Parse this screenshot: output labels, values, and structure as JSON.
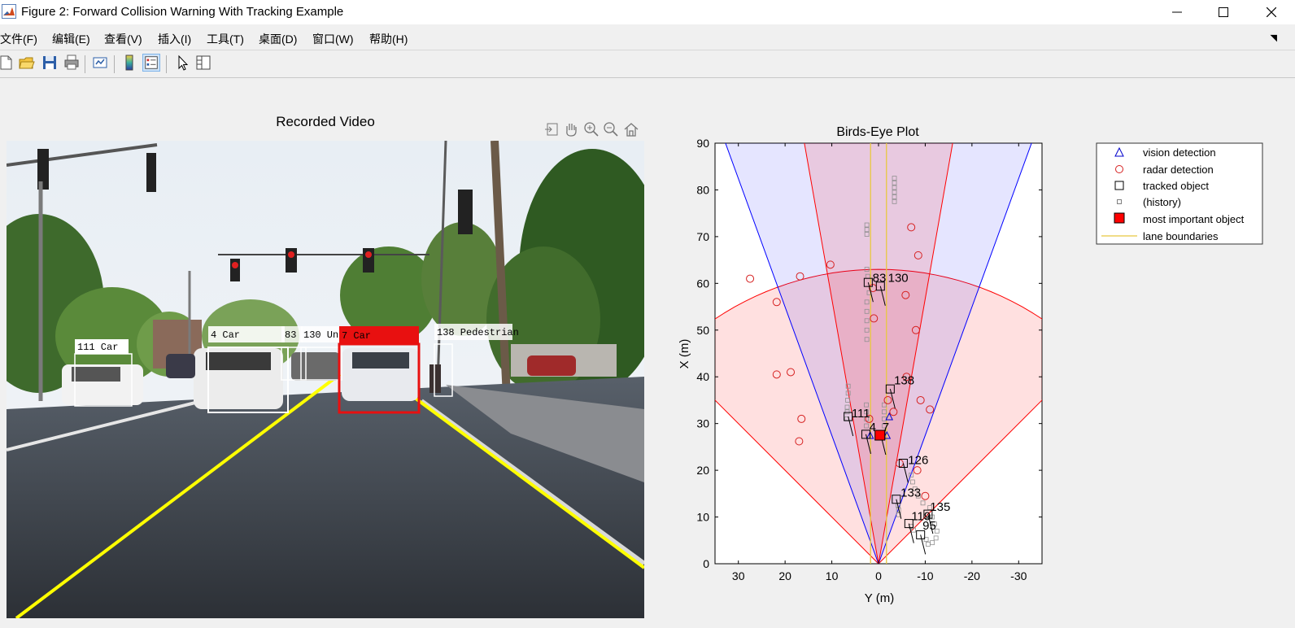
{
  "window": {
    "title": "Figure 2: Forward Collision Warning With Tracking Example",
    "controls": [
      "minimize",
      "maximize",
      "close"
    ]
  },
  "menu": [
    {
      "label": "文件(F)"
    },
    {
      "label": "编辑(E)"
    },
    {
      "label": "查看(V)"
    },
    {
      "label": "插入(I)"
    },
    {
      "label": "工具(T)"
    },
    {
      "label": "桌面(D)"
    },
    {
      "label": "窗口(W)"
    },
    {
      "label": "帮助(H)"
    }
  ],
  "toolbar": {
    "icons": [
      "new-figure-icon",
      "open-file-icon",
      "save-icon",
      "print-icon",
      "link-plot-icon",
      "insert-colorbar-icon",
      "insert-legend-icon",
      "edit-plot-icon",
      "property-inspector-icon"
    ],
    "active": "insert-legend-icon"
  },
  "axes_toolbar": {
    "icons": [
      "export-icon",
      "pan-icon",
      "zoom-in-icon",
      "zoom-out-icon",
      "home-icon"
    ]
  },
  "video": {
    "title": "Recorded Video",
    "boxes": [
      {
        "label": "111  Car",
        "color": "#ffffff"
      },
      {
        "label": "4  Car",
        "color": "#ffffff"
      },
      {
        "label": "83",
        "color": "#ffffff"
      },
      {
        "label": "130  Unknown",
        "color": "#ffffff"
      },
      {
        "label": "7  Car",
        "color": "#e81010"
      },
      {
        "label": "138  Pedestrian",
        "color": "#ffffff"
      }
    ],
    "lane_color": "#ffff00"
  },
  "plot": {
    "title": "Birds-Eye Plot",
    "xlabel": "Y (m)",
    "ylabel": "X (m)",
    "x_ticks": [
      "30",
      "20",
      "10",
      "0",
      "-10",
      "-20",
      "-30"
    ],
    "y_ticks": [
      "0",
      "10",
      "20",
      "30",
      "40",
      "50",
      "60",
      "70",
      "80",
      "90"
    ],
    "legend": [
      {
        "label": "vision detection",
        "marker": "triangle",
        "color": "#0000cc"
      },
      {
        "label": "radar detection",
        "marker": "circle",
        "color": "#d62020"
      },
      {
        "label": "tracked object",
        "marker": "square",
        "color": "#000000"
      },
      {
        "label": "(history)",
        "marker": "small-square",
        "color": "#808080"
      },
      {
        "label": "most important object",
        "marker": "filled-square",
        "color": "#ff0000"
      },
      {
        "label": "lane boundaries",
        "marker": "line",
        "color": "#e8c840"
      }
    ],
    "track_labels": [
      {
        "id": "83",
        "y": 1.8,
        "x": 60
      },
      {
        "id": "130",
        "y": -1.5,
        "x": 60
      },
      {
        "id": "138",
        "y": -2.8,
        "x": 38
      },
      {
        "id": "111",
        "y": 6.3,
        "x": 31
      },
      {
        "id": "4",
        "y": 2.5,
        "x": 28
      },
      {
        "id": "7",
        "y": -0.3,
        "x": 28
      },
      {
        "id": "126",
        "y": -5.8,
        "x": 21
      },
      {
        "id": "133",
        "y": -4.2,
        "x": 14
      },
      {
        "id": "135",
        "y": -10.5,
        "x": 11
      },
      {
        "id": "119",
        "y": -6.5,
        "x": 9
      },
      {
        "id": "95",
        "y": -8.9,
        "x": 7
      }
    ],
    "radar_detections": [
      [
        27.5,
        61
      ],
      [
        21.8,
        56
      ],
      [
        16.8,
        61.5
      ],
      [
        10.3,
        64
      ],
      [
        -7,
        72
      ],
      [
        -8.5,
        66
      ],
      [
        -5.8,
        57.5
      ],
      [
        -8,
        50
      ],
      [
        1,
        52.5
      ],
      [
        1.2,
        59
      ],
      [
        -6,
        40
      ],
      [
        21.8,
        40.5
      ],
      [
        18.8,
        41
      ],
      [
        -9,
        35
      ],
      [
        -11,
        33
      ],
      [
        -3.2,
        32.5
      ],
      [
        -2,
        35
      ],
      [
        16.5,
        31
      ],
      [
        17,
        26.2
      ],
      [
        2,
        31
      ],
      [
        -4.5,
        21.5
      ],
      [
        -8.3,
        20
      ],
      [
        -10,
        14.5
      ]
    ],
    "vision_detections": [
      [
        -2.3,
        31.5
      ],
      [
        1.8,
        27.5
      ],
      [
        -1.8,
        27.5
      ]
    ],
    "tracked_objects": [
      [
        2.2,
        60.2
      ],
      [
        -0.4,
        59.4
      ],
      [
        -2.5,
        37.4
      ],
      [
        6.5,
        31.5
      ],
      [
        2.7,
        27.7
      ],
      [
        -0.5,
        27.5
      ],
      [
        -5.3,
        21.5
      ],
      [
        -3.8,
        13.8
      ],
      [
        -10.6,
        10.6
      ],
      [
        -6.5,
        8.6
      ],
      [
        -9,
        6.2
      ]
    ],
    "most_important": [
      -0.3,
      27.5
    ],
    "history": [
      [
        -3.4,
        82.5
      ],
      [
        -3.4,
        81.5
      ],
      [
        -3.4,
        80.5
      ],
      [
        -3.4,
        79.5
      ],
      [
        -3.4,
        78.5
      ],
      [
        -3.4,
        77.5
      ],
      [
        2.5,
        72.5
      ],
      [
        2.5,
        71.5
      ],
      [
        2.5,
        70.5
      ],
      [
        2.5,
        63
      ],
      [
        2.3,
        61.5
      ],
      [
        2,
        58
      ],
      [
        2.5,
        56
      ],
      [
        2.5,
        54
      ],
      [
        2.5,
        52
      ],
      [
        2.5,
        50
      ],
      [
        2.5,
        48
      ],
      [
        6.5,
        38
      ],
      [
        6.5,
        36.5
      ],
      [
        6.6,
        35
      ],
      [
        6.7,
        33.5
      ],
      [
        6.7,
        32.5
      ],
      [
        6.8,
        31
      ],
      [
        2.6,
        34
      ],
      [
        2.6,
        32.5
      ],
      [
        2.6,
        31
      ],
      [
        2.6,
        29.5
      ],
      [
        -1.2,
        34
      ],
      [
        -1.2,
        32.5
      ],
      [
        -1.2,
        31
      ],
      [
        -1.2,
        29.5
      ],
      [
        -7,
        19
      ],
      [
        -7.3,
        17.5
      ],
      [
        -7.8,
        16
      ],
      [
        -8.5,
        14.5
      ],
      [
        -9.5,
        13
      ],
      [
        -4.2,
        12.5
      ],
      [
        -4.3,
        11.5
      ],
      [
        -4.3,
        10.5
      ],
      [
        -11,
        12
      ],
      [
        -11.5,
        10
      ],
      [
        -12,
        8.5
      ],
      [
        -12.5,
        7
      ],
      [
        -12.3,
        5.5
      ],
      [
        -11.5,
        4.5
      ],
      [
        -7,
        8
      ],
      [
        -7.5,
        7.2
      ],
      [
        -10.2,
        5.2
      ],
      [
        -10.6,
        4.2
      ]
    ],
    "lane_boundaries": [
      1.7,
      -1.7
    ],
    "coverage": {
      "radar_long": {
        "range": 63,
        "half_angle_deg": 45,
        "color": "#ff0000"
      },
      "radar_mid": {
        "range": 100,
        "half_angle_deg": 10,
        "color": "#ff0000"
      },
      "vision": {
        "range": 100,
        "half_angle_deg": 20,
        "color": "#0000ff"
      }
    },
    "xlim": [
      35,
      -35
    ],
    "ylim": [
      0,
      90
    ]
  }
}
